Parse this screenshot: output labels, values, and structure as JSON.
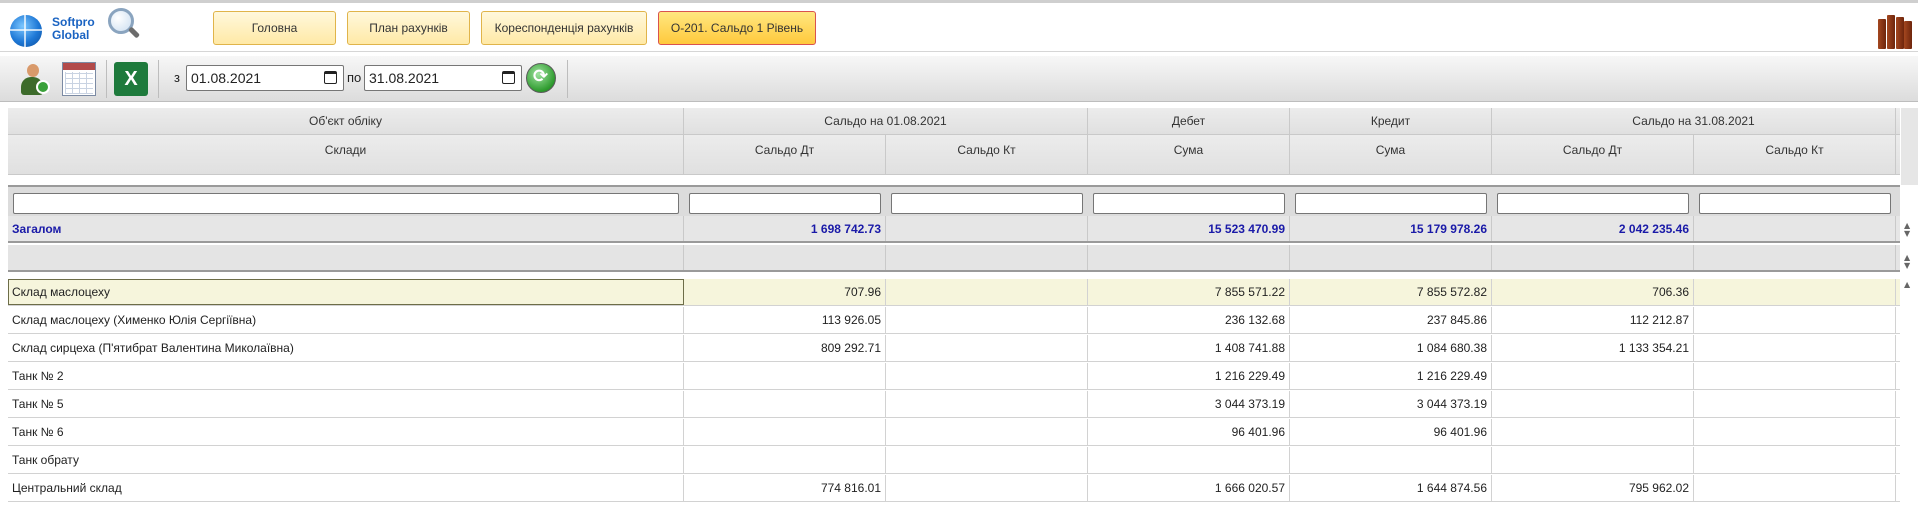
{
  "header": {
    "logo_line1": "Softpro",
    "logo_line2": "Global",
    "tabs": [
      {
        "label": "Головна",
        "active": false
      },
      {
        "label": "План рахунків",
        "active": false
      },
      {
        "label": "Кореспонденція рахунків",
        "active": false
      },
      {
        "label": "О-201. Сальдо 1 Рівень",
        "active": true
      }
    ]
  },
  "toolbar": {
    "from_label": "з",
    "from_date": "01.08.2021",
    "to_label": "по",
    "to_date": "31.08.2021",
    "excel_icon_text": "X"
  },
  "table": {
    "group_headers": [
      "Об'єкт обліку",
      "Сальдо на 01.08.2021",
      "Дебет",
      "Кредит",
      "Сальдо на 31.08.2021"
    ],
    "sub_headers": [
      "Склади",
      "Сальдо Дт",
      "Сальдо Кт",
      "Сума",
      "Сума",
      "Сальдо Дт",
      "Сальдо Кт"
    ],
    "total": {
      "label": "Загалом",
      "values": [
        "1 698 742.73",
        "",
        "15 523 470.99",
        "15 179 978.26",
        "2 042 235.46",
        ""
      ]
    },
    "rows": [
      {
        "name": "Склад маслоцеху",
        "values": [
          "707.96",
          "",
          "7 855 571.22",
          "7 855 572.82",
          "706.36",
          ""
        ]
      },
      {
        "name": "Склад маслоцеху (Хименко Юлія Сергіївна)",
        "values": [
          "113 926.05",
          "",
          "236 132.68",
          "237 845.86",
          "112 212.87",
          ""
        ]
      },
      {
        "name": "Склад сирцеха (П'ятибрат Валентина Миколаївна)",
        "values": [
          "809 292.71",
          "",
          "1 408 741.88",
          "1 084 680.38",
          "1 133 354.21",
          ""
        ]
      },
      {
        "name": "Танк № 2",
        "values": [
          "",
          "",
          "1 216 229.49",
          "1 216 229.49",
          "",
          ""
        ]
      },
      {
        "name": "Танк № 5",
        "values": [
          "",
          "",
          "3 044 373.19",
          "3 044 373.19",
          "",
          ""
        ]
      },
      {
        "name": "Танк № 6",
        "values": [
          "",
          "",
          "96 401.96",
          "96 401.96",
          "",
          ""
        ]
      },
      {
        "name": "Танк обрату",
        "values": [
          "",
          "",
          "",
          "",
          "",
          ""
        ]
      },
      {
        "name": "Центральний склад",
        "values": [
          "774 816.01",
          "",
          "1 666 020.57",
          "1 644 874.56",
          "795 962.02",
          ""
        ]
      }
    ],
    "selected_row": 0
  }
}
